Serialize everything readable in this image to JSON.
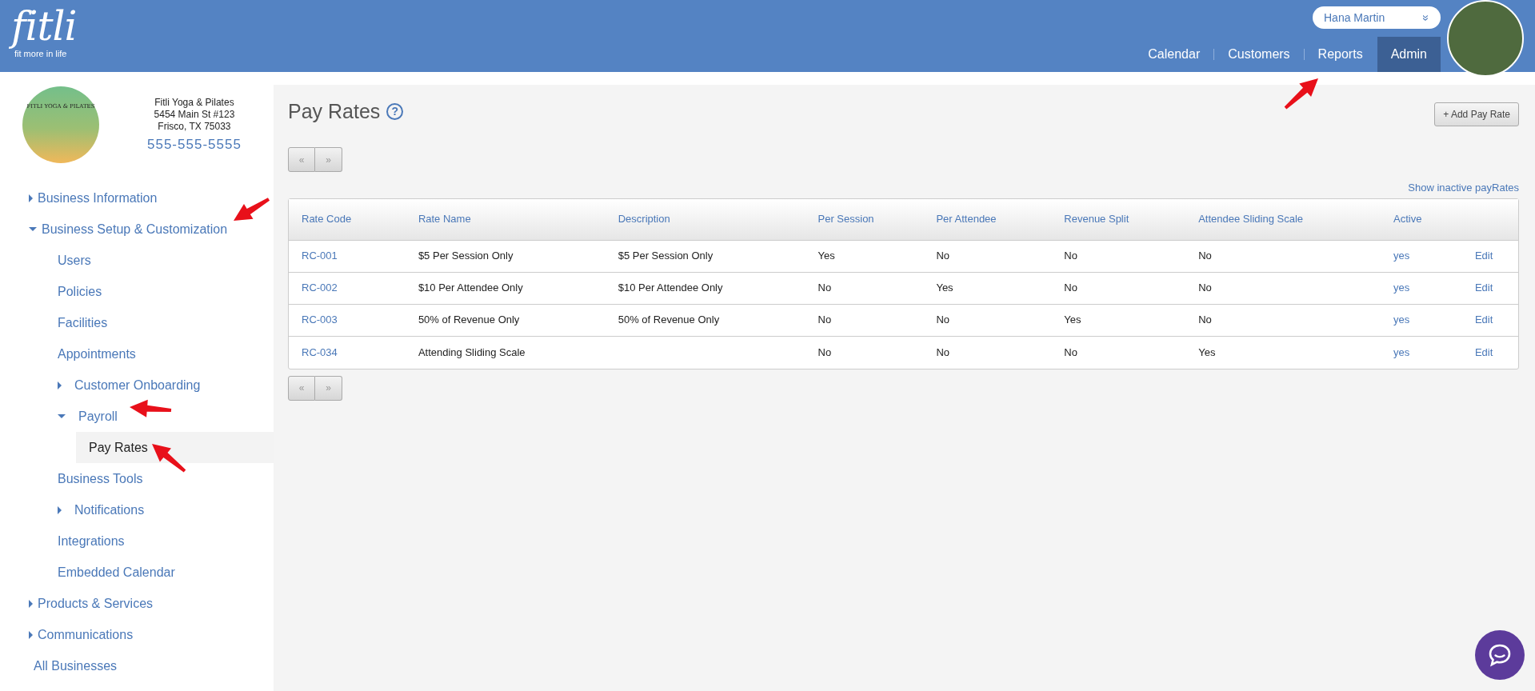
{
  "header": {
    "logo": "fitli",
    "tagline": "fit more in life",
    "user_menu": {
      "name": "Hana Martin",
      "chevron": "»"
    },
    "nav": [
      {
        "label": "Calendar",
        "selected": false
      },
      {
        "label": "Customers",
        "selected": false
      },
      {
        "label": "Reports",
        "selected": false
      },
      {
        "label": "Admin",
        "selected": true
      }
    ]
  },
  "sidebar": {
    "business": {
      "name": "Fitli Yoga & Pilates",
      "address_lines": [
        "5454 Main St #123",
        "Frisco, TX 75033"
      ],
      "phone": "555-555-5555",
      "logo_text": "FITLI YOGA & PILATES"
    },
    "items": [
      {
        "label": "Business Information",
        "kind": "group",
        "expanded": false,
        "selected": false
      },
      {
        "label": "Business Setup & Customization",
        "kind": "group",
        "expanded": true,
        "selected": false,
        "children": [
          {
            "label": "Users",
            "kind": "link",
            "selected": false
          },
          {
            "label": "Policies",
            "kind": "link",
            "selected": false
          },
          {
            "label": "Facilities",
            "kind": "link",
            "selected": false
          },
          {
            "label": "Appointments",
            "kind": "link",
            "selected": false
          },
          {
            "label": "Customer Onboarding",
            "kind": "group",
            "expanded": false,
            "selected": false
          },
          {
            "label": "Payroll",
            "kind": "group",
            "expanded": true,
            "selected": false,
            "children": [
              {
                "label": "Pay Rates",
                "kind": "link",
                "selected": true
              }
            ]
          },
          {
            "label": "Business Tools",
            "kind": "link",
            "selected": false
          },
          {
            "label": "Notifications",
            "kind": "group",
            "expanded": false,
            "selected": false
          },
          {
            "label": "Integrations",
            "kind": "link",
            "selected": false
          },
          {
            "label": "Embedded Calendar",
            "kind": "link",
            "selected": false
          }
        ]
      },
      {
        "label": "Products & Services",
        "kind": "group",
        "expanded": false,
        "selected": false
      },
      {
        "label": "Communications",
        "kind": "group",
        "expanded": false,
        "selected": false
      },
      {
        "label": "All Businesses",
        "kind": "link",
        "selected": false
      }
    ]
  },
  "main": {
    "title": "Pay Rates",
    "help": "?",
    "add_button": "+ Add Pay Rate",
    "pager_top": {
      "prev": "«",
      "next": "»",
      "prev_disabled": true,
      "next_disabled": true
    },
    "show_inactive_link": "Show inactive payRates",
    "table": {
      "columns": [
        "Rate Code",
        "Rate Name",
        "Description",
        "Per Session",
        "Per Attendee",
        "Revenue Split",
        "Attendee Sliding Scale",
        "Active"
      ],
      "rows": [
        {
          "code": "RC-001",
          "name": "$5 Per Session Only",
          "description": "$5 Per Session Only",
          "per_session": "Yes",
          "per_attendee": "No",
          "revenue_split": "No",
          "sliding_scale": "No",
          "active": "yes",
          "action": "Edit"
        },
        {
          "code": "RC-002",
          "name": "$10 Per Attendee Only",
          "description": "$10 Per Attendee Only",
          "per_session": "No",
          "per_attendee": "Yes",
          "revenue_split": "No",
          "sliding_scale": "No",
          "active": "yes",
          "action": "Edit"
        },
        {
          "code": "RC-003",
          "name": "50% of Revenue Only",
          "description": "50% of Revenue Only",
          "per_session": "No",
          "per_attendee": "No",
          "revenue_split": "Yes",
          "sliding_scale": "No",
          "active": "yes",
          "action": "Edit"
        },
        {
          "code": "RC-034",
          "name": "Attending Sliding Scale",
          "per_session": "No",
          "per_attendee": "No",
          "revenue_split": "No",
          "sliding_scale": "Yes",
          "active": "yes",
          "action": "Edit"
        }
      ]
    },
    "pager_bottom": {
      "prev": "«",
      "next": "»",
      "prev_disabled": true,
      "next_disabled": true
    }
  }
}
